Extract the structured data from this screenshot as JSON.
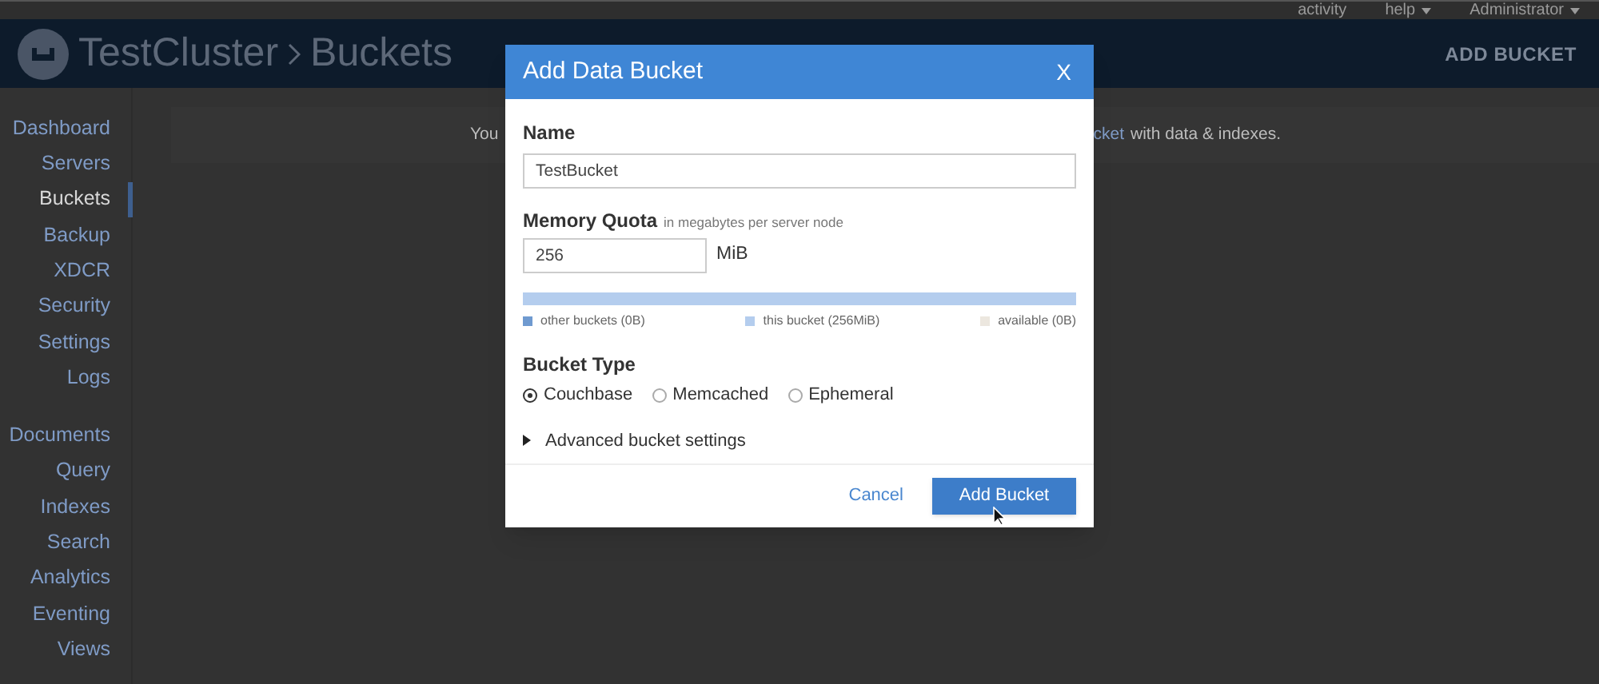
{
  "top_bar": {
    "links": [
      {
        "label": "activity",
        "caret": false
      },
      {
        "label": "help",
        "caret": true
      },
      {
        "label": "Administrator",
        "caret": true
      }
    ]
  },
  "header": {
    "cluster": "TestCluster",
    "page": "Buckets",
    "action": "ADD BUCKET"
  },
  "sidebar": {
    "groups": [
      [
        {
          "label": "Dashboard",
          "selected": false
        },
        {
          "label": "Servers",
          "selected": false
        },
        {
          "label": "Buckets",
          "selected": true
        },
        {
          "label": "Backup",
          "selected": false
        },
        {
          "label": "XDCR",
          "selected": false
        },
        {
          "label": "Security",
          "selected": false
        },
        {
          "label": "Settings",
          "selected": false
        },
        {
          "label": "Logs",
          "selected": false
        }
      ],
      [
        {
          "label": "Documents",
          "selected": false
        },
        {
          "label": "Query",
          "selected": false
        },
        {
          "label": "Indexes",
          "selected": false
        },
        {
          "label": "Search",
          "selected": false
        },
        {
          "label": "Analytics",
          "selected": false
        },
        {
          "label": "Eventing",
          "selected": false
        },
        {
          "label": "Views",
          "selected": false
        }
      ]
    ]
  },
  "notice": {
    "left": "You",
    "right_link": "cket",
    "right": "with data & indexes."
  },
  "dialog": {
    "title": "Add Data Bucket",
    "close": "X",
    "name": {
      "label": "Name",
      "value": "TestBucket"
    },
    "memory_quota": {
      "label": "Memory Quota",
      "hint": "in megabytes per server node",
      "value": "256",
      "unit": "MiB",
      "level": 1,
      "legend": [
        {
          "label": "other buckets (0B)",
          "color": "#6f9ad0"
        },
        {
          "label": "this bucket (256MiB)",
          "color": "#b4cdee"
        },
        {
          "label": "available (0B)",
          "color": "#ece7df"
        }
      ]
    },
    "bucket_type": {
      "label": "Bucket Type",
      "options": [
        {
          "label": "Couchbase",
          "selected": true
        },
        {
          "label": "Memcached",
          "selected": false
        },
        {
          "label": "Ephemeral",
          "selected": false
        }
      ]
    },
    "advanced": {
      "label": "Advanced bucket settings",
      "expanded": false
    },
    "buttons": {
      "cancel": "Cancel",
      "submit": "Add Bucket"
    }
  }
}
